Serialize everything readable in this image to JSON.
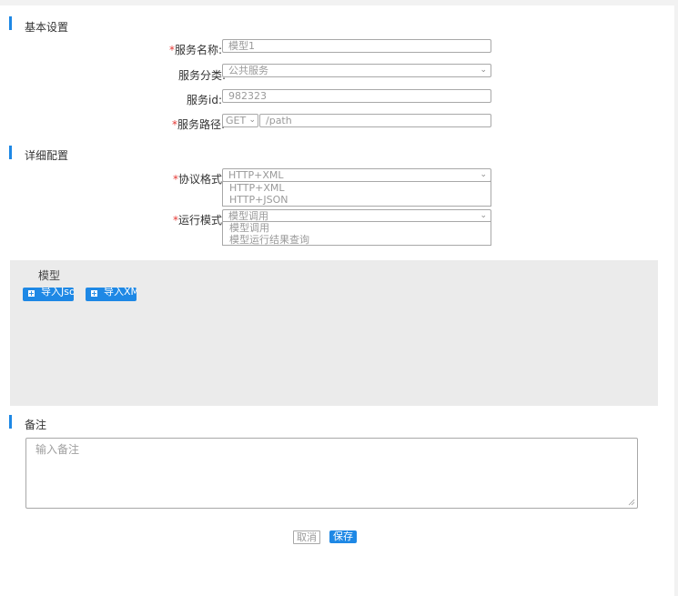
{
  "sections": {
    "basic": "基本设置",
    "detail": "详细配置",
    "remark": "备注"
  },
  "basic_form": {
    "service_name": {
      "label": "服务名称",
      "value": "模型1"
    },
    "service_category": {
      "label": "服务分类",
      "value": "公共服务"
    },
    "service_id": {
      "label": "服务id",
      "value": "982323"
    },
    "service_path": {
      "label": "服务路径",
      "method": "GET",
      "path": "/path"
    }
  },
  "required_mark": "*",
  "label_suffix": ":",
  "detail_form": {
    "protocol": {
      "label": "协议格式",
      "value": "HTTP+XML",
      "options": [
        "HTTP+XML",
        "HTTP+JSON"
      ]
    },
    "run_mode": {
      "label": "运行模式",
      "value": "模型调用",
      "options": [
        "模型调用",
        "模型运行结果查询"
      ]
    }
  },
  "model_panel": {
    "title": "模型",
    "import_json_label": "导入Json",
    "import_xml_label": "导入XML"
  },
  "remark": {
    "placeholder": "输入备注"
  },
  "actions": {
    "cancel_label": "取消",
    "save_label": "保存"
  },
  "icons": {
    "chevron": "chevron-down-icon",
    "plus": "plus-square-icon",
    "resize": "resize-grip-icon"
  },
  "colors": {
    "accent": "#1e88e5",
    "required": "#e53935",
    "panel_bg": "#ebebeb"
  }
}
